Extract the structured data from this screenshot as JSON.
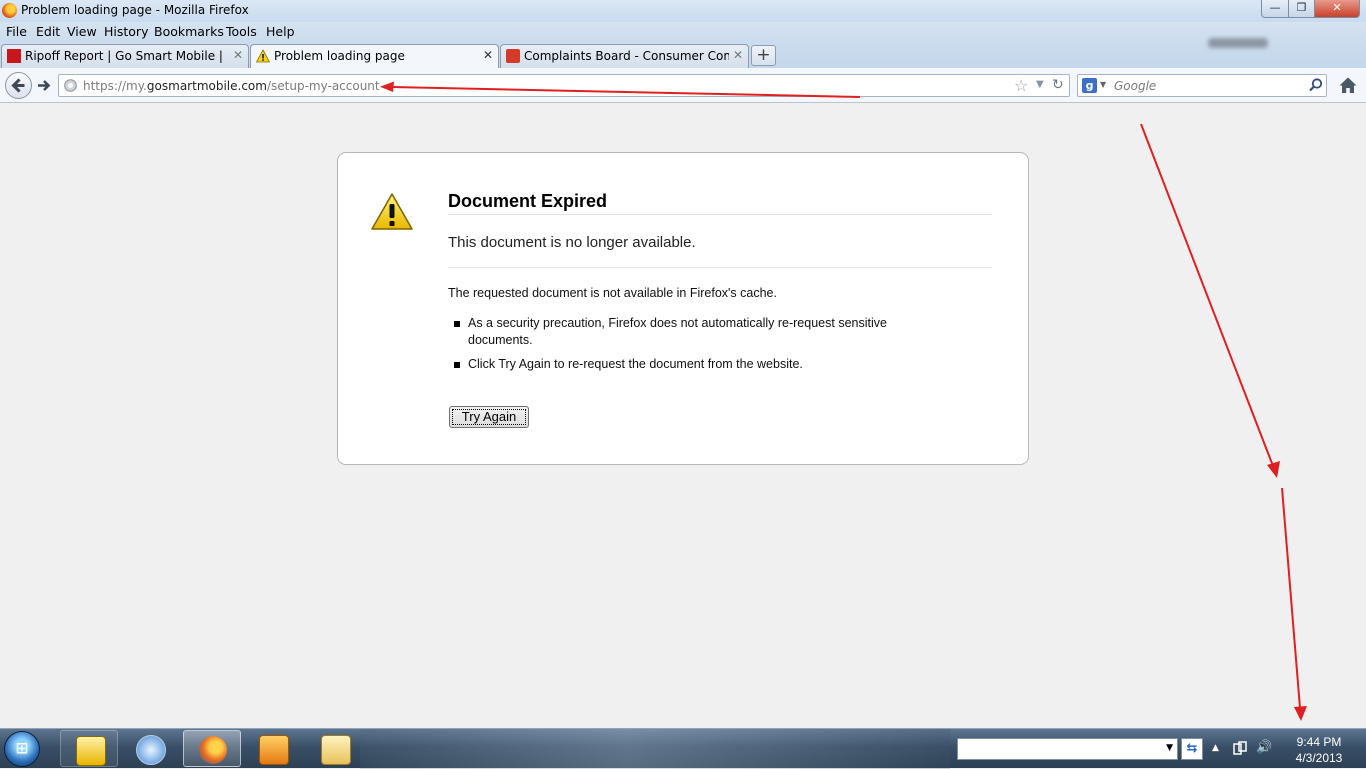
{
  "window": {
    "title": "Problem loading page - Mozilla Firefox",
    "min_label": "—",
    "max_label": "❐",
    "close_label": "✕"
  },
  "menu": [
    "File",
    "Edit",
    "View",
    "History",
    "Bookmarks",
    "Tools",
    "Help"
  ],
  "tabs": [
    {
      "label": "Ripoff Report | Go Smart Mobile | Co...",
      "icon": "ripoff-report-favicon",
      "active": false
    },
    {
      "label": "Problem loading page",
      "icon": "warning-icon",
      "active": true
    },
    {
      "label": "Complaints Board - Consumer Comp...",
      "icon": "complaints-board-favicon",
      "active": false
    }
  ],
  "newtab_label": "+",
  "nav": {
    "url_prefix": "https://my.",
    "url_domain": "gosmartmobile.com",
    "url_path": "/setup-my-account",
    "search_placeholder": "Google",
    "search_engine_letter": "g"
  },
  "error": {
    "title": "Document Expired",
    "subtitle": "This document is no longer available.",
    "description": "The requested document is not available in Firefox's cache.",
    "bullets": [
      "As a security precaution, Firefox does not automatically re-request sensitive documents.",
      "Click Try Again to re-request the document from the website."
    ],
    "button_label": "Try Again"
  },
  "taskbar": {
    "start_label": "⊞",
    "apps": [
      "outlook-icon",
      "safari-icon",
      "firefox-icon",
      "media-player-icon",
      "explorer-icon"
    ],
    "swap_label": "⇆",
    "tray_up": "▲",
    "tray_speaker": "🔊",
    "time": "9:44 PM",
    "date": "4/3/2013"
  },
  "colors": {
    "annotation_arrow": "#e02020",
    "accent": "#3b70c6"
  }
}
